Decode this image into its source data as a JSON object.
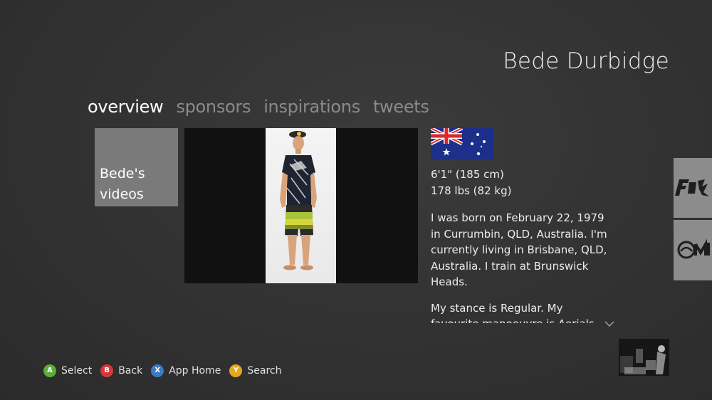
{
  "header": {
    "title": "Bede Durbidge"
  },
  "tabs": [
    {
      "label": "overview",
      "active": true
    },
    {
      "label": "sponsors",
      "active": false
    },
    {
      "label": "inspirations",
      "active": false
    },
    {
      "label": "tweets",
      "active": false
    }
  ],
  "videos_tile": {
    "label": "Bede's videos"
  },
  "profile": {
    "flag": "australia-flag",
    "height": "6'1\" (185 cm)",
    "weight": "178 lbs (82 kg)",
    "bio": "I was born on February 22, 1979 in Currumbin, QLD, Australia. I'm currently living in Brisbane, QLD, Australia. I train at Brunswick Heads.",
    "bio_more": "My stance is Regular. My favourite manoeuvre is Aerials"
  },
  "sponsor_tiles": [
    {
      "icon": "fox-logo"
    },
    {
      "icon": "oneill-logo"
    }
  ],
  "controller_hints": [
    {
      "button": "A",
      "label": "Select",
      "color": "#5cae3b"
    },
    {
      "button": "B",
      "label": "Back",
      "color": "#d6393a"
    },
    {
      "button": "X",
      "label": "App Home",
      "color": "#3a7cc4"
    },
    {
      "button": "Y",
      "label": "Search",
      "color": "#e3a81f"
    }
  ],
  "colors": {
    "background": "#323232",
    "tile": "#7a7a7a",
    "inactive_tab": "#8a8a8a"
  }
}
